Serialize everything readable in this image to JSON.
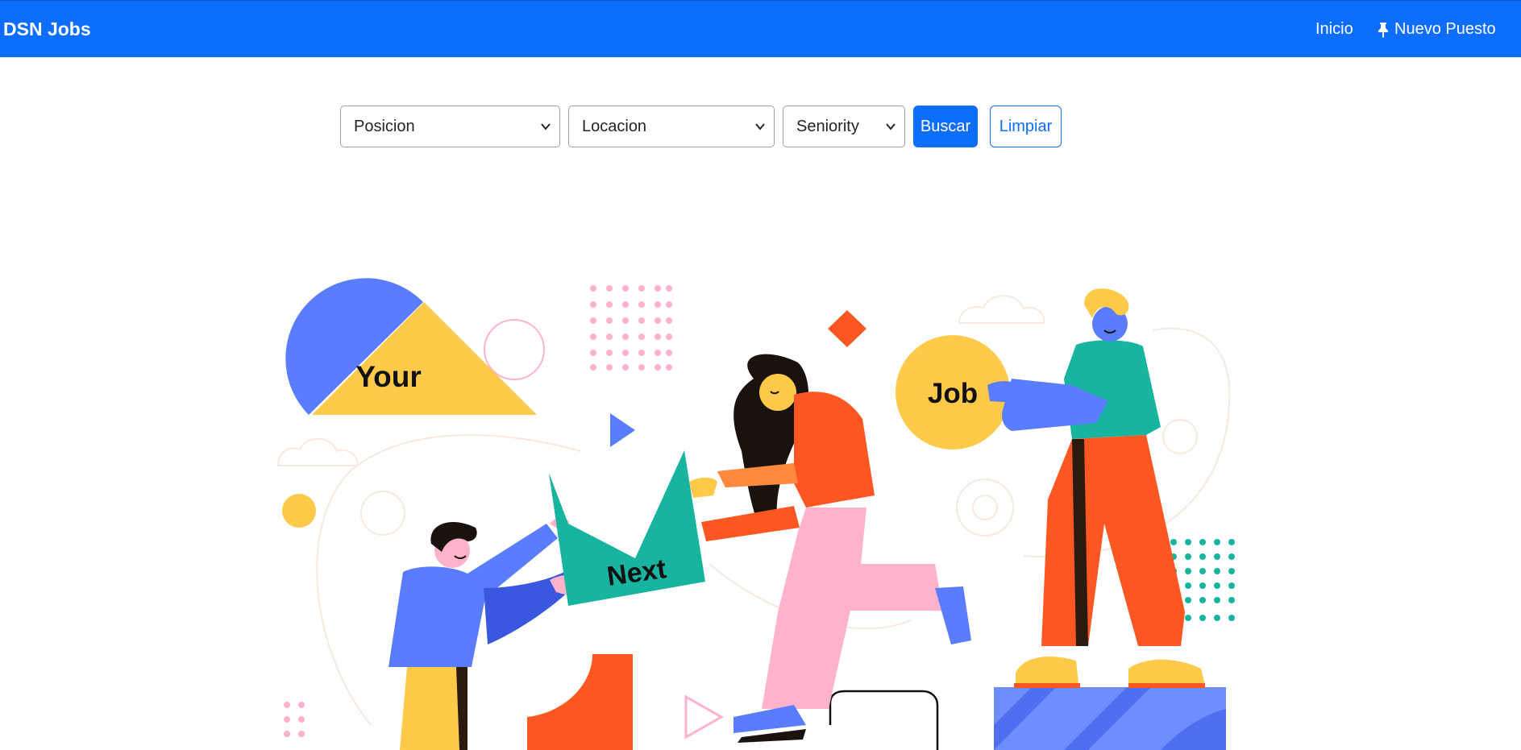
{
  "navbar": {
    "brand": "DSN Jobs",
    "links": [
      {
        "label": "Inicio",
        "icon": null
      },
      {
        "label": "Nuevo Puesto",
        "icon": "pin-icon"
      }
    ],
    "background_color": "#0d6efd"
  },
  "filters": {
    "position": {
      "selected": "Posicion"
    },
    "location": {
      "selected": "Locacion"
    },
    "seniority": {
      "selected": "Seniority"
    },
    "search_label": "Buscar",
    "clear_label": "Limpiar"
  },
  "hero": {
    "words": [
      "Your",
      "Next",
      "Job"
    ]
  },
  "colors": {
    "primary": "#0d6efd",
    "blue": "#5a7cff",
    "yellow": "#ffc94a",
    "orange": "#ff5722",
    "teal": "#17b5a0",
    "pink": "#ffb3cb"
  }
}
